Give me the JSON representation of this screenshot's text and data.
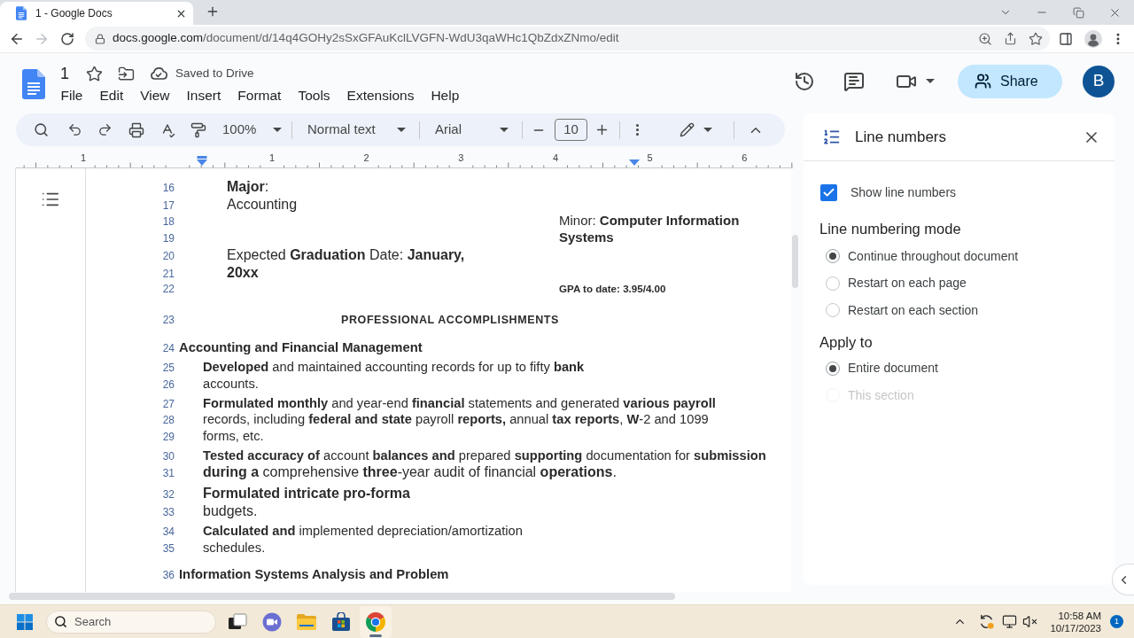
{
  "browser": {
    "tab": {
      "title": "1 - Google Docs"
    },
    "address": {
      "host": "docs.google.com",
      "path": "/document/d/14q4GOHy2sSxGFAuKclLVGFN-WdU3qaWHc1QbZdxZNmo/edit"
    }
  },
  "header": {
    "title": "1",
    "save_status": "Saved to Drive",
    "menu": [
      "File",
      "Edit",
      "View",
      "Insert",
      "Format",
      "Tools",
      "Extensions",
      "Help"
    ],
    "share": "Share",
    "avatar": "B"
  },
  "toolbar": {
    "zoom": "100%",
    "style": "Normal text",
    "font": "Arial",
    "font_size": "10"
  },
  "ruler": {
    "labels": [
      "1",
      "1",
      "2",
      "3",
      "4",
      "5",
      "6"
    ]
  },
  "document": {
    "paragraphs": [
      {
        "kind": "field",
        "lines": [
          {
            "number": "16",
            "text": "**Major**:",
            "large": false
          },
          {
            "number": "17",
            "text": "Accounting",
            "large": false
          }
        ]
      },
      {
        "kind": "side",
        "lines": [
          {
            "number": "18",
            "text": "Minor: **Computer Information**",
            "large": false
          },
          {
            "number": "19",
            "text": "**Systems**",
            "large": false
          }
        ]
      },
      {
        "kind": "field",
        "lines": [
          {
            "number": "20",
            "text": "Expected **Graduation** Date: **January,**",
            "large": false
          },
          {
            "number": "21",
            "text": "**20xx**",
            "large": false
          }
        ]
      },
      {
        "kind": "note",
        "lines": [
          {
            "number": "22",
            "text": "GPA to date: 3.95/4.00",
            "large": false
          }
        ]
      },
      {
        "kind": "title",
        "lines": [
          {
            "number": "23",
            "text": "PROFESSIONAL ACCOMPLISHMENTS",
            "large": false
          }
        ]
      },
      {
        "kind": "heading",
        "lines": [
          {
            "number": "24",
            "text": "Accounting and Financial Management",
            "large": false
          }
        ]
      },
      {
        "kind": "body",
        "lines": [
          {
            "number": "25",
            "text": "**Developed** and maintained accounting records for up to fifty **bank**",
            "large": false
          },
          {
            "number": "26",
            "text": "accounts.",
            "large": false
          }
        ]
      },
      {
        "kind": "body",
        "lines": [
          {
            "number": "27",
            "text": "**Formulated monthly** and year-end **financial** statements and generated **various payroll**",
            "large": false
          },
          {
            "number": "28",
            "text": "records, including **federal and state** payroll **reports,** annual **tax reports**, **W**-2 and 1099",
            "large": false
          },
          {
            "number": "29",
            "text": "forms, etc.",
            "large": false
          }
        ]
      },
      {
        "kind": "body",
        "lines": [
          {
            "number": "30",
            "text": "**Tested accuracy of** account **balances and** prepared **supporting** documentation for **submission**",
            "large": false
          },
          {
            "number": "31",
            "text": "**during a** comprehensive **three**-year audit of financial **operations**.",
            "large": true
          }
        ]
      },
      {
        "kind": "body",
        "lines": [
          {
            "number": "32",
            "text": "**Formulated intricate pro-forma**",
            "large": true
          },
          {
            "number": "33",
            "text": "budgets.",
            "large": true
          }
        ]
      },
      {
        "kind": "body",
        "lines": [
          {
            "number": "34",
            "text": "**Calculated and** implemented depreciation/amortization",
            "large": false
          },
          {
            "number": "35",
            "text": "schedules.",
            "large": false
          }
        ]
      },
      {
        "kind": "heading",
        "lines": [
          {
            "number": "36",
            "text": "Information Systems Analysis and Problem",
            "large": false
          }
        ]
      }
    ]
  },
  "side_panel": {
    "title": "Line numbers",
    "show_numbers": {
      "label": "Show line numbers",
      "checked": true
    },
    "mode": {
      "heading": "Line numbering mode",
      "options": [
        {
          "label": "Continue throughout document",
          "selected": true
        },
        {
          "label": "Restart on each page",
          "selected": false
        },
        {
          "label": "Restart on each section",
          "selected": false
        }
      ]
    },
    "apply_to": {
      "heading": "Apply to",
      "options": [
        {
          "label": "Entire document",
          "selected": true,
          "disabled": false
        },
        {
          "label": "This section",
          "selected": false,
          "disabled": true
        }
      ]
    }
  },
  "taskbar": {
    "search": {
      "placeholder": "Search"
    },
    "apps": [
      {
        "kind": "task-view",
        "active": false
      },
      {
        "kind": "chat",
        "active": false
      },
      {
        "kind": "files",
        "active": false
      },
      {
        "kind": "store",
        "active": false
      },
      {
        "kind": "browser",
        "active": true
      }
    ],
    "clock": {
      "time": "10:58 AM",
      "date": "10/17/2023"
    },
    "notifications": "1"
  }
}
